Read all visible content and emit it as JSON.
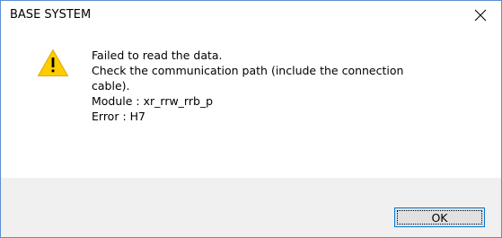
{
  "window": {
    "title": "BASE SYSTEM",
    "close_icon": "close-icon"
  },
  "message": {
    "icon": "warning-icon",
    "lines": [
      "Failed to read the data.",
      "Check the communication path (include the connection",
      "cable).",
      "Module : xr_rrw_rrb_p",
      "Error : H7"
    ]
  },
  "buttons": {
    "ok_label": "OK"
  },
  "colors": {
    "warning_fill": "#ffcc00",
    "accent": "#0078d7",
    "footer_bg": "#f0f0f0"
  }
}
